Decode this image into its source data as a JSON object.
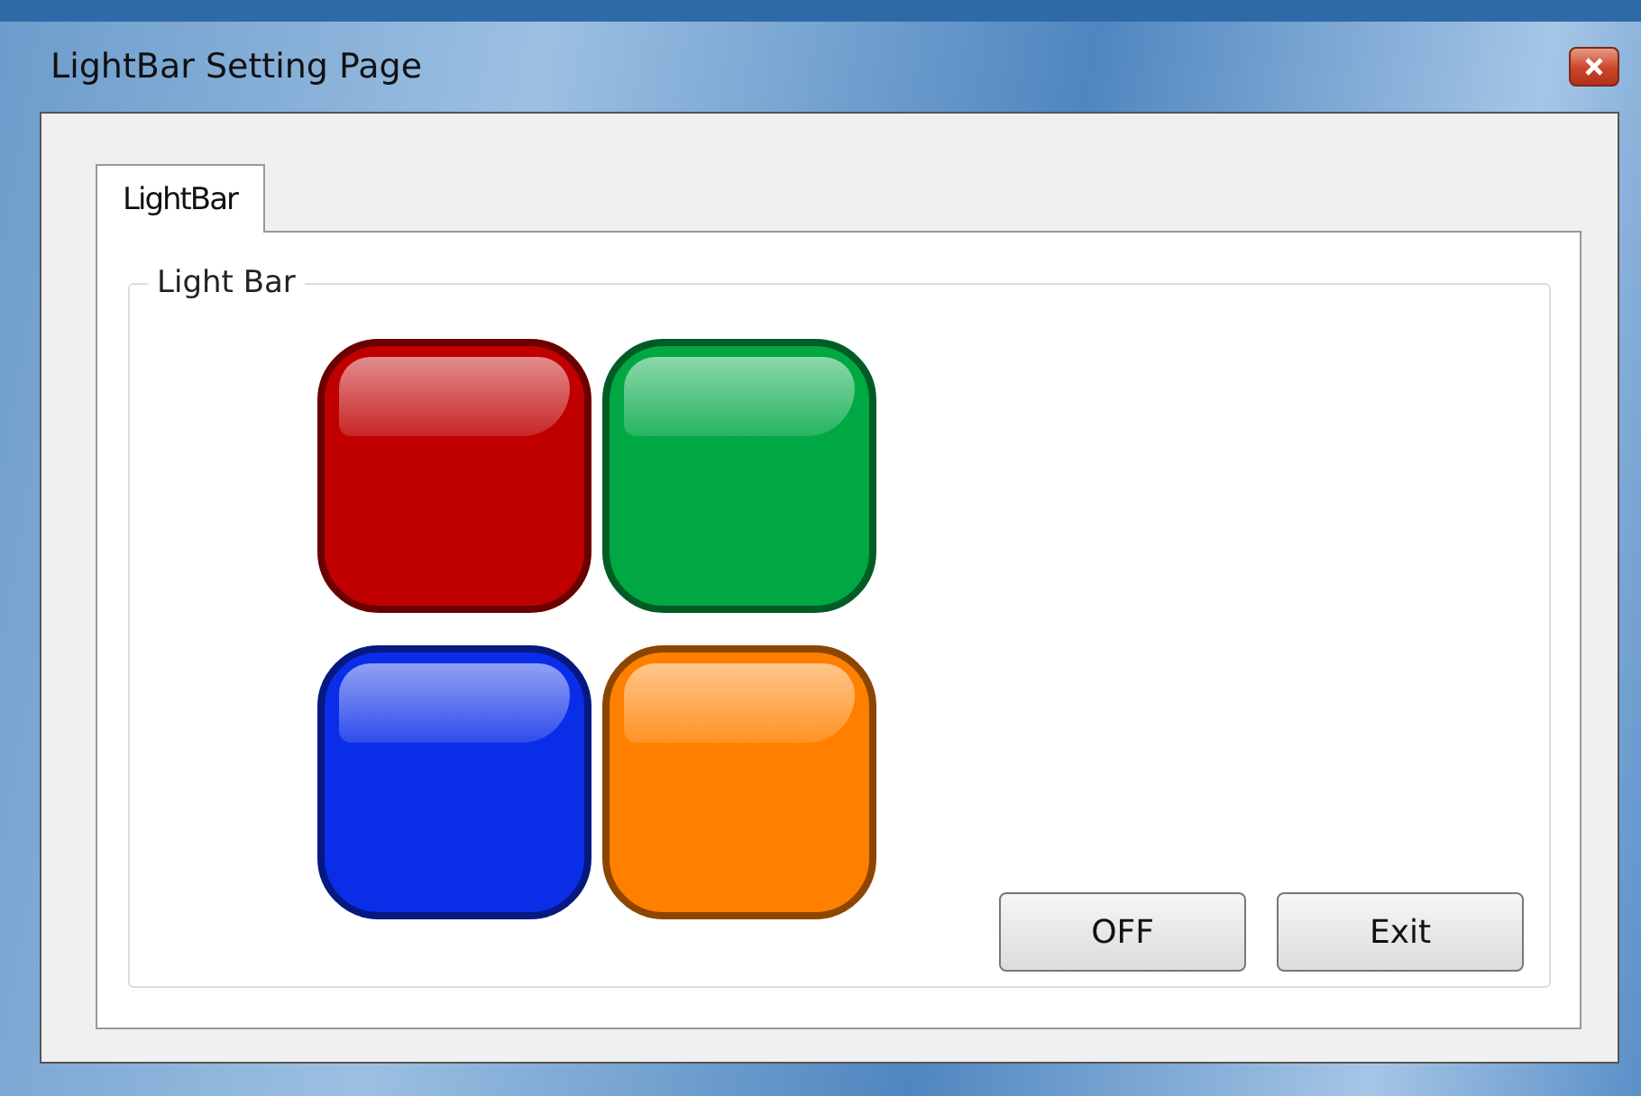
{
  "window": {
    "title": "LightBar Setting Page"
  },
  "tabs": [
    {
      "label": "LightBar",
      "selected": true
    }
  ],
  "group": {
    "label": "Light Bar"
  },
  "lights": [
    {
      "color": "#c00000"
    },
    {
      "color": "#00a844"
    },
    {
      "color": "#0a2ee8"
    },
    {
      "color": "#ff8000"
    }
  ],
  "buttons": [
    "OFF",
    "Exit"
  ]
}
